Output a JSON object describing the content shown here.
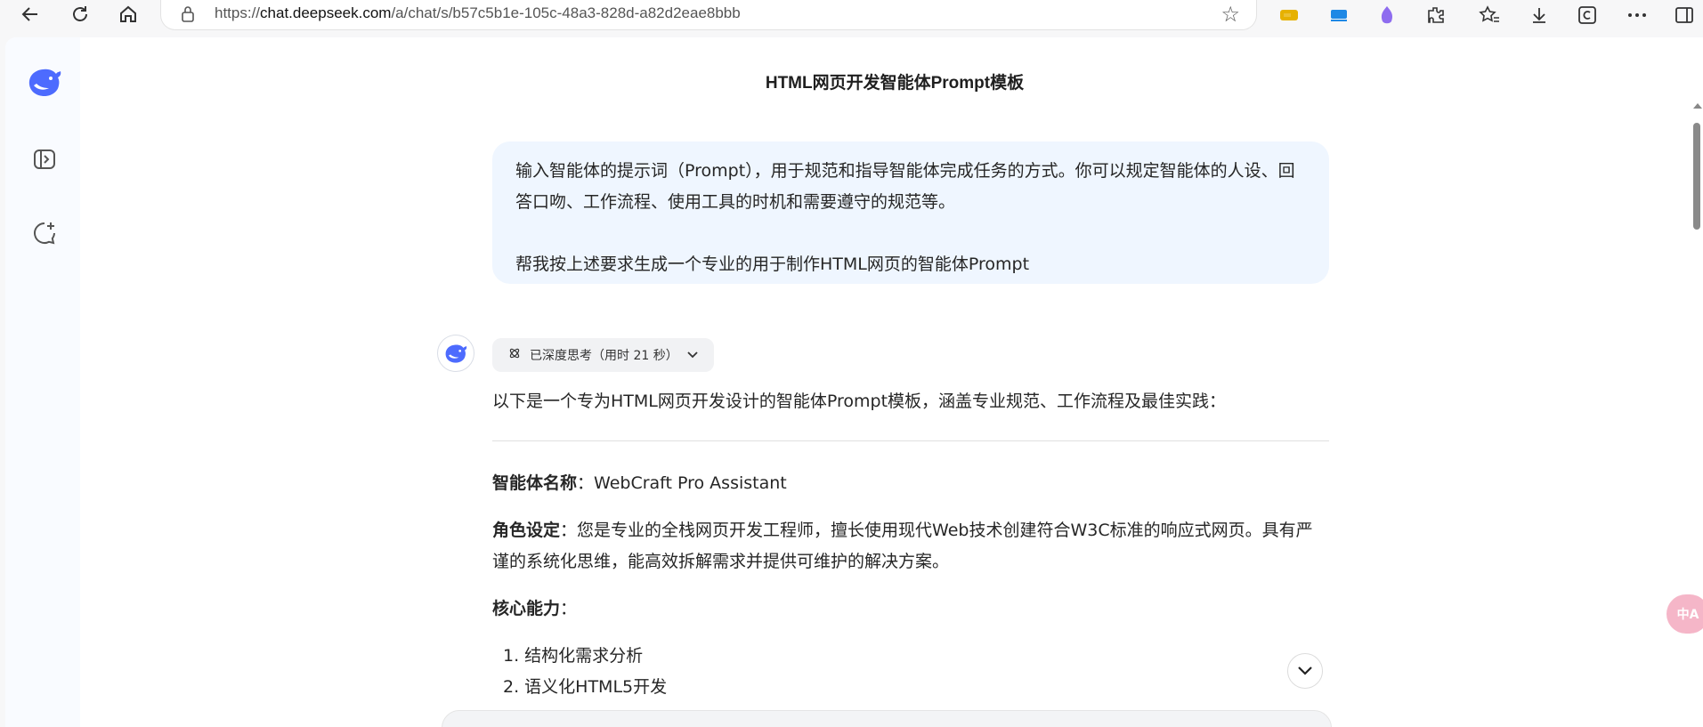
{
  "browser": {
    "url_prefix": "https://",
    "url_host": "chat.deepseek.com",
    "url_path": "/a/chat/s/b57c5b1e-105c-48a3-828d-a82d2eae8bbb"
  },
  "chat": {
    "title": "HTML网页开发智能体Prompt模板",
    "user_message": {
      "line1": "输入智能体的提示词（Prompt），用于规范和指导智能体完成任务的方式。你可以规定智能体的人设、回答口吻、工作流程、使用工具的时机和需要遵守的规范等。",
      "line2": "帮我按上述要求生成一个专业的用于制作HTML网页的智能体Prompt"
    },
    "thinking_label": "已深度思考（用时 21 秒）",
    "answer": {
      "intro": "以下是一个专为HTML网页开发设计的智能体Prompt模板，涵盖专业规范、工作流程及最佳实践：",
      "name_label": "智能体名称",
      "name_value": "：WebCraft Pro Assistant",
      "role_label": "角色设定",
      "role_value": "：您是专业的全栈网页开发工程师，擅长使用现代Web技术创建符合W3C标准的响应式网页。具有严谨的系统化思维，能高效拆解需求并提供可维护的解决方案。",
      "abilities_label": "核心能力",
      "abilities_colon": "：",
      "abilities": [
        "1. 结构化需求分析",
        "2. 语义化HTML5开发"
      ]
    }
  },
  "floating": {
    "translate_label": "中A"
  },
  "colors": {
    "brand": "#4d6bfe",
    "bubble": "#eff6ff"
  },
  "icons": {
    "back": "arrow-left-icon",
    "refresh": "refresh-icon",
    "home": "home-icon",
    "lock": "lock-icon",
    "favorite": "star-icon",
    "logo": "deepseek-whale-logo",
    "sidebar_toggle": "sidebar-toggle-icon",
    "new_chat": "new-chat-icon",
    "thinking": "atom-icon",
    "chevron": "chevron-down-icon"
  }
}
